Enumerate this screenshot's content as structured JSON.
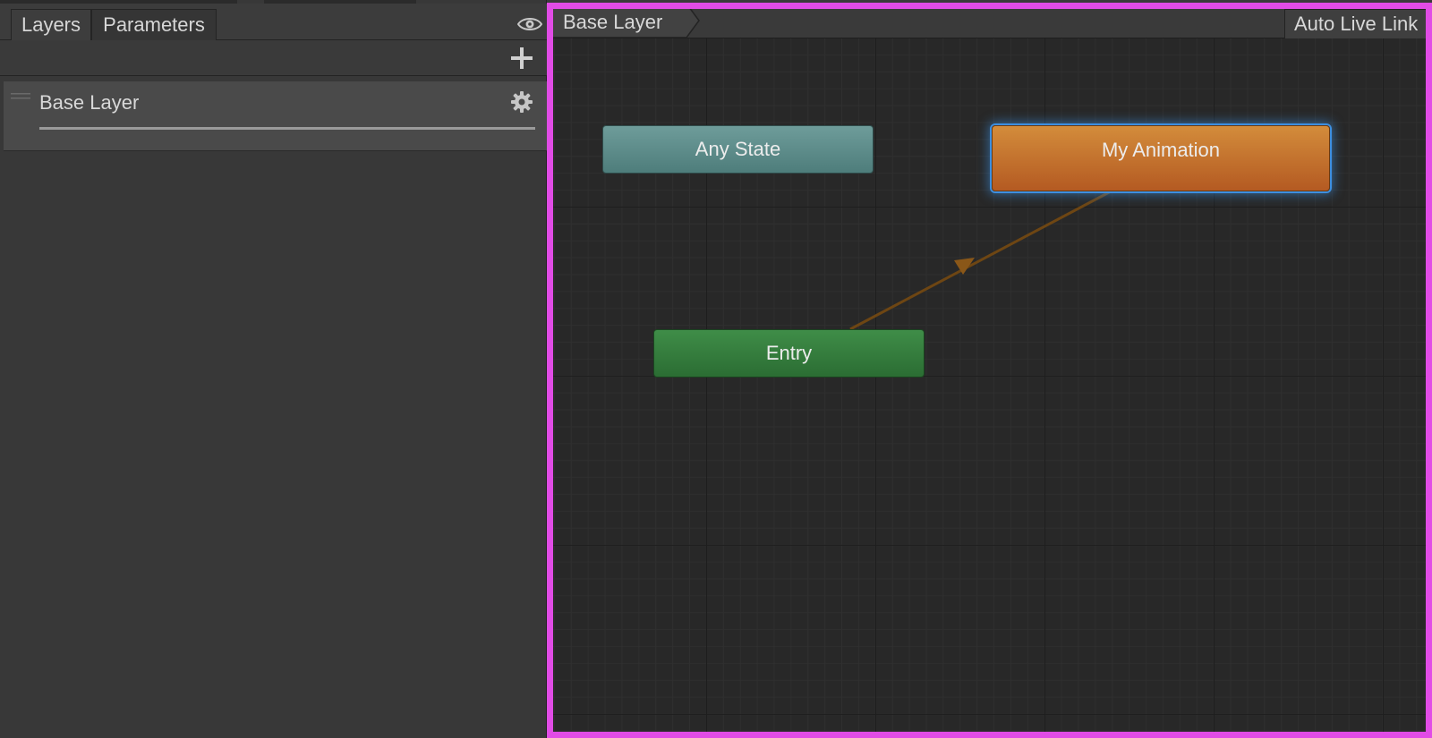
{
  "tabs": [
    {
      "label": "Layers",
      "active": true
    },
    {
      "label": "Parameters",
      "active": false
    }
  ],
  "layers": [
    {
      "name": "Base Layer",
      "weight": 1.0
    }
  ],
  "graph": {
    "breadcrumb": "Base Layer",
    "live_link_label": "Auto Live Link",
    "states": {
      "any_state": "Any State",
      "entry": "Entry",
      "default_state": "My Animation"
    },
    "transitions": [
      {
        "from": "Entry",
        "to": "My Animation"
      }
    ]
  },
  "colors": {
    "any_state": "#5f8e8c",
    "entry": "#357d3e",
    "default_state": "#c8722e",
    "transition": "#7a4b13",
    "selection_frame": "#e14ce6",
    "highlight": "#3d8fe0"
  },
  "icons": {
    "visibility": "eye-icon",
    "add": "plus-icon",
    "layer_settings": "gear-icon",
    "drag": "drag-handle-icon"
  }
}
